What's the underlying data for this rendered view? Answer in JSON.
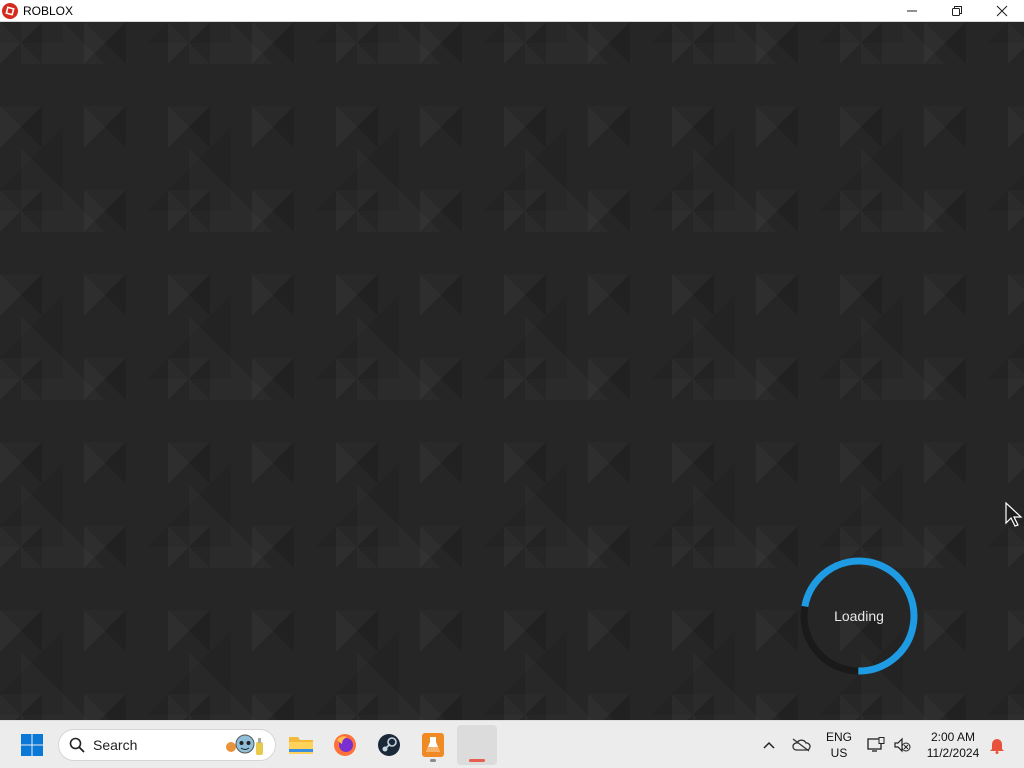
{
  "window": {
    "title": "ROBLOX",
    "logo_icon": "roblox-logo-icon",
    "controls": [
      "minimize-icon",
      "restore-icon",
      "close-icon"
    ]
  },
  "game": {
    "loading_text": "Loading",
    "spinner_color": "#1e9be3"
  },
  "taskbar": {
    "search_label": "Search",
    "pinned": [
      "windows-start-icon",
      "file-explorer-icon",
      "firefox-icon",
      "steam-icon",
      "lab-flask-icon",
      "roblox-app-icon"
    ],
    "tray": {
      "language_line1": "ENG",
      "language_line2": "US",
      "time": "2:00 AM",
      "date": "11/2/2024"
    },
    "colors": {
      "start_blue": "#0a78d7",
      "roblox_indicator": "#e65f50",
      "notification": "#e8513b"
    }
  }
}
